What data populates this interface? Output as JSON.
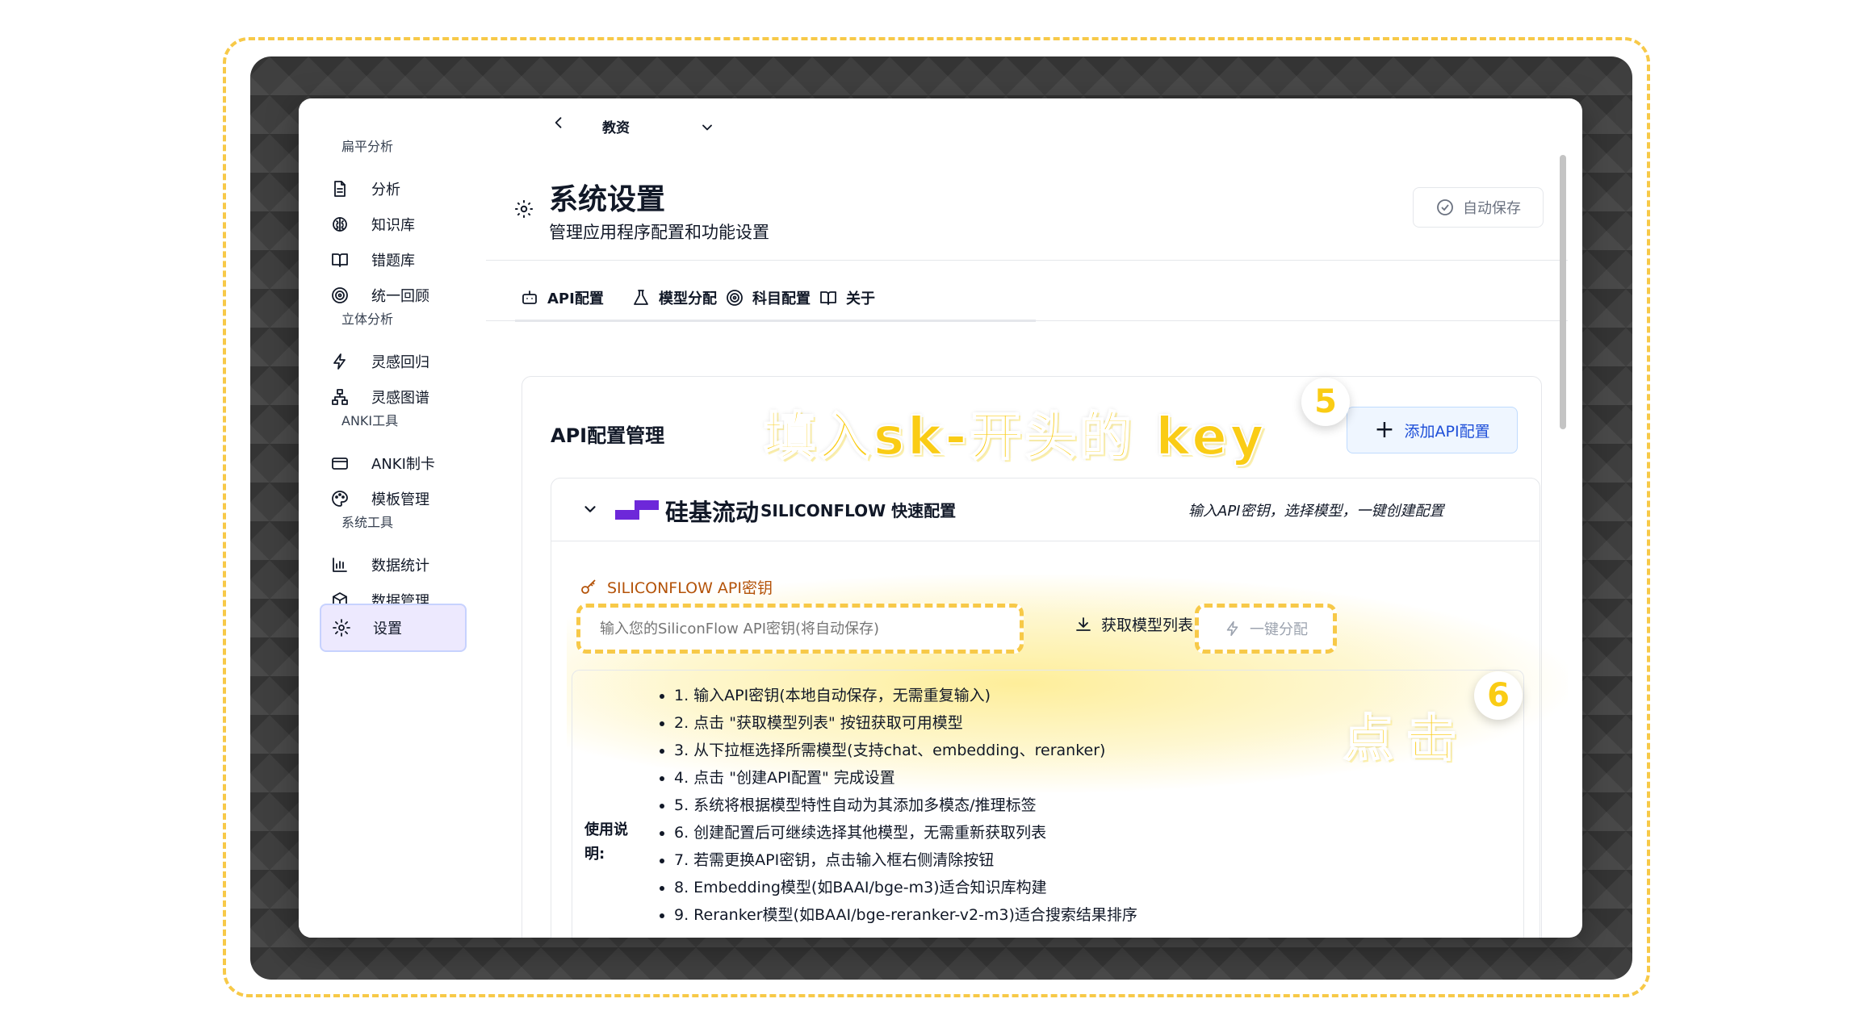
{
  "sidebar": {
    "sections": [
      {
        "title": "扁平分析",
        "items": [
          {
            "label": "分析",
            "icon": "document-icon"
          },
          {
            "label": "知识库",
            "icon": "brain-icon"
          },
          {
            "label": "错题库",
            "icon": "book-open-icon"
          },
          {
            "label": "统一回顾",
            "icon": "target-icon"
          }
        ]
      },
      {
        "title": "立体分析",
        "items": [
          {
            "label": "灵感回归",
            "icon": "lightning-icon"
          },
          {
            "label": "灵感图谱",
            "icon": "network-icon"
          }
        ]
      },
      {
        "title": "ANKI工具",
        "items": [
          {
            "label": "ANKI制卡",
            "icon": "card-icon"
          },
          {
            "label": "模板管理",
            "icon": "palette-icon"
          }
        ]
      },
      {
        "title": "系统工具",
        "items": [
          {
            "label": "数据统计",
            "icon": "bar-chart-icon"
          },
          {
            "label": "数据管理",
            "icon": "cube-icon"
          },
          {
            "label": "设置",
            "icon": "gear-icon",
            "active": true
          }
        ]
      }
    ]
  },
  "topbar": {
    "subject_select": "教资"
  },
  "header": {
    "title": "系统设置",
    "subtitle": "管理应用程序配置和功能设置",
    "autosave_label": "自动保存"
  },
  "tabs": [
    {
      "label": "API配置",
      "icon": "robot-icon",
      "active": true
    },
    {
      "label": "模型分配",
      "icon": "flask-icon"
    },
    {
      "label": "科目配置",
      "icon": "target-icon"
    },
    {
      "label": "关于",
      "icon": "book-open-icon"
    }
  ],
  "api_card": {
    "title": "API配置管理",
    "add_button": "添加API配置",
    "siliconflow": {
      "brand": "硅基流动",
      "quick_label": "SILICONFLOW 快速配置",
      "hint": "输入API密钥，选择模型，一键创建配置",
      "key_label": "SILICONFLOW API密钥",
      "key_placeholder": "输入您的SiliconFlow API密钥(将自动保存)",
      "fetch_button": "获取模型列表",
      "one_click_button": "一键分配",
      "instructions_label": "使用说明:",
      "instructions": [
        "1. 输入API密钥(本地自动保存，无需重复输入)",
        "2. 点击 \"获取模型列表\" 按钮获取可用模型",
        "3. 从下拉框选择所需模型(支持chat、embedding、reranker)",
        "4. 点击 \"创建API配置\" 完成设置",
        "5. 系统将根据模型特性自动为其添加多模态/推理标签",
        "6. 创建配置后可继续选择其他模型，无需重新获取列表",
        "7. 若需更换API密钥，点击输入框右侧清除按钮",
        "8. Embedding模型(如BAAI/bge-m3)适合知识库构建",
        "9. Reranker模型(如BAAI/bge-reranker-v2-m3)适合搜索结果排序"
      ]
    }
  },
  "annotations": {
    "step5_text": "填入sk-开头的 key",
    "step5_badge": "5",
    "step6_text": "点击",
    "step6_badge": "6"
  },
  "colors": {
    "accent_yellow": "#facc15",
    "active_nav_bg": "#ede9fe",
    "link_blue": "#1d4ed8",
    "siliconflow_purple": "#6d28d9"
  }
}
